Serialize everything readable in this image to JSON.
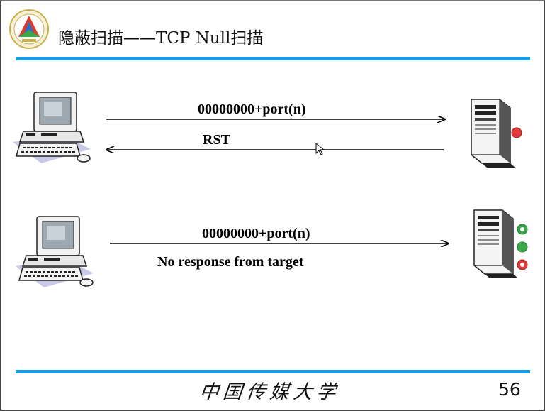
{
  "slide": {
    "title": "隐蔽扫描——TCP Null扫描",
    "footer_school": "中国传媒大学",
    "page_number": "56",
    "accent_color": "#1e9be0"
  },
  "scenario_open": {
    "probe_label": "00000000+port(n)",
    "reply_label": "RST"
  },
  "scenario_closed": {
    "probe_label": "00000000+port(n)",
    "note": "No response from target"
  },
  "icons": {
    "logo": "university-logo-icon",
    "client": "desktop-computer-icon",
    "server": "server-tower-icon",
    "status": "status-light-icon",
    "cursor": "mouse-cursor-icon"
  }
}
